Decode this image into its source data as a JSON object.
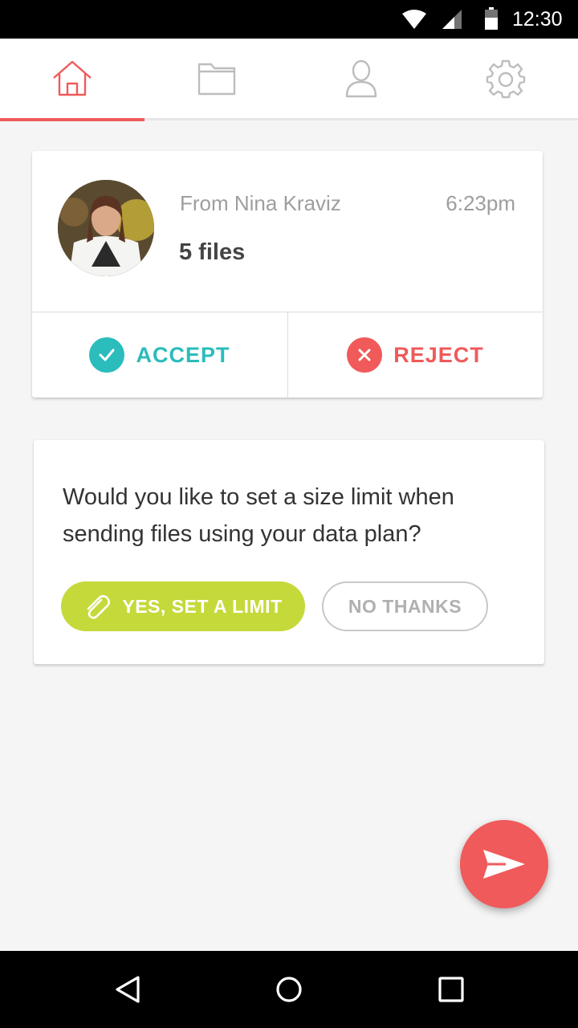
{
  "status_bar": {
    "time": "12:30",
    "icons": [
      "wifi-icon",
      "signal-icon",
      "battery-icon"
    ]
  },
  "tabs": [
    {
      "name": "home",
      "icon": "home-icon",
      "active": true
    },
    {
      "name": "files",
      "icon": "folder-icon",
      "active": false
    },
    {
      "name": "profile",
      "icon": "person-icon",
      "active": false
    },
    {
      "name": "settings",
      "icon": "gear-icon",
      "active": false
    }
  ],
  "incoming": {
    "from": "From Nina Kraviz",
    "time": "6:23pm",
    "files": "5 files",
    "accept_label": "ACCEPT",
    "reject_label": "REJECT"
  },
  "limit_prompt": {
    "question": "Would you like to set a size limit when sending files using your data plan?",
    "yes_label": "YES, SET A LIMIT",
    "no_label": "NO THANKS"
  },
  "colors": {
    "accent_red": "#f05a5a",
    "accept_teal": "#2bbcbc",
    "yes_green": "#c5d93a"
  },
  "nav_bar": {
    "icons": [
      "back-icon",
      "home-circle-icon",
      "recents-icon"
    ]
  }
}
